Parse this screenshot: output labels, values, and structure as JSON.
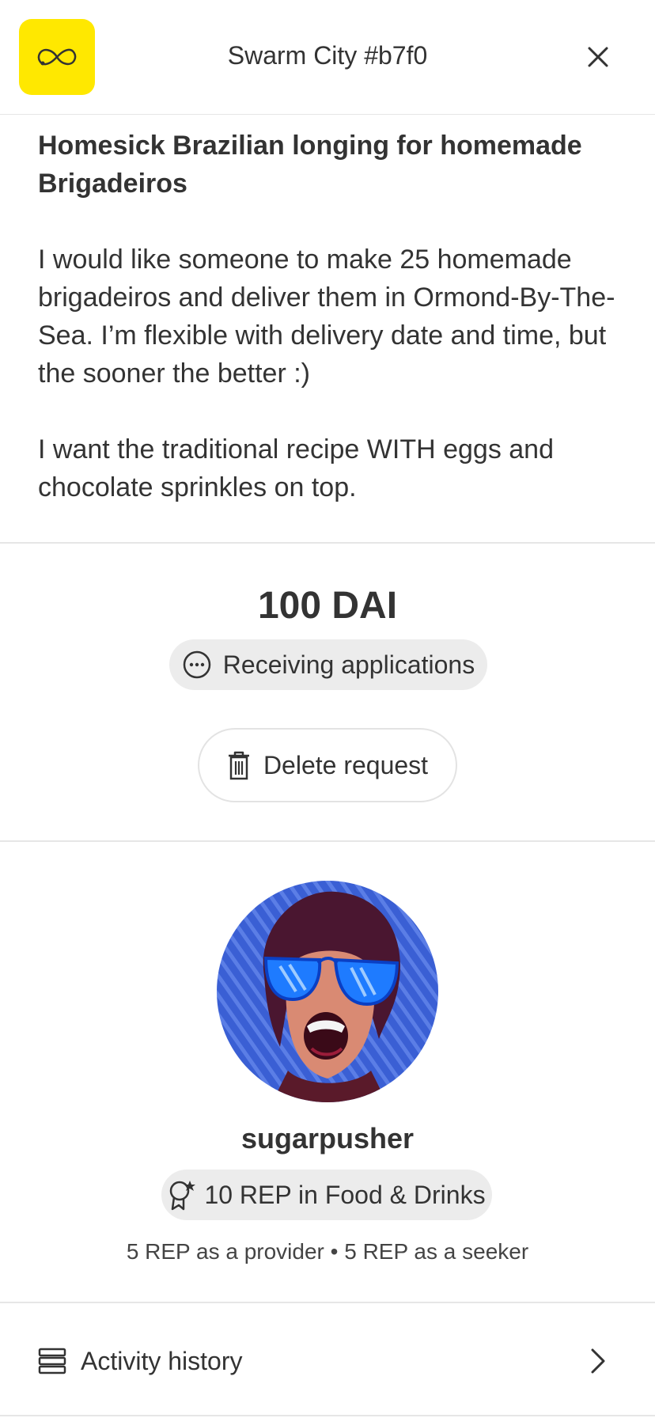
{
  "header": {
    "title": "Swarm City #b7f0",
    "logo_icon": "infinity-logo-icon",
    "close_icon": "close-icon",
    "accent": "#FFE800"
  },
  "request": {
    "title": "Homesick Brazilian longing for homemade Brigadeiros",
    "paragraph1": "I would like someone to make 25 homemade brigadeiros and deliver them in Ormond-By-The-Sea. I’m flexible with delivery date and time, but the sooner the better :)",
    "paragraph2": "I want the traditional recipe WITH eggs and chocolate sprinkles on top."
  },
  "deal": {
    "amount": "100 DAI",
    "status": "Receiving applications",
    "status_icon": "ellipsis-circle-icon",
    "delete_label": "Delete request",
    "delete_icon": "trash-icon"
  },
  "seeker": {
    "username": "sugarpusher",
    "rep_badge": "10 REP in Food & Drinks",
    "rep_icon": "rosette-star-icon",
    "rep_breakdown": "5 REP as a provider • 5 REP as a seeker"
  },
  "activity": {
    "label": "Activity history",
    "icon": "list-stack-icon",
    "chevron": "chevron-right-icon"
  }
}
